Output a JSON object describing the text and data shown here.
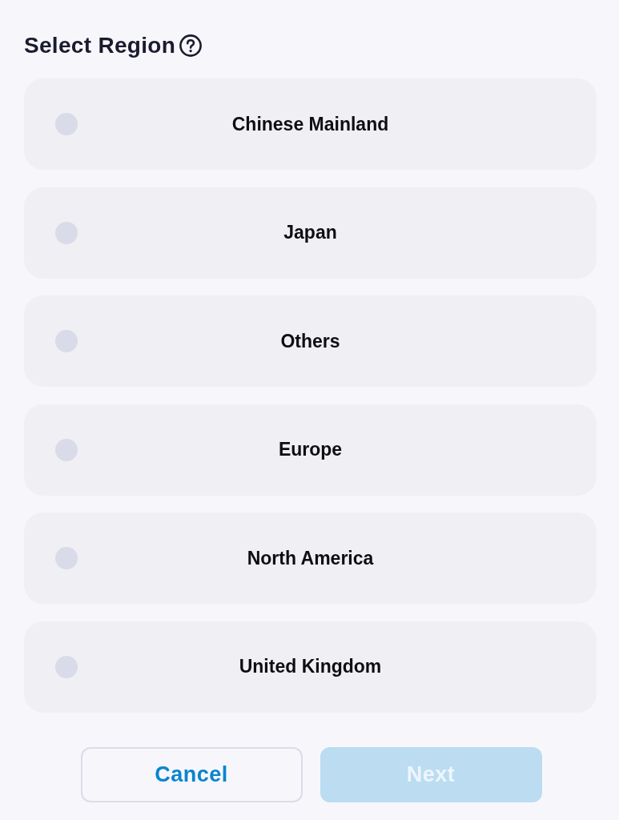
{
  "title": "Select Region",
  "regions": [
    {
      "label": "Chinese Mainland",
      "selected": false
    },
    {
      "label": "Japan",
      "selected": false
    },
    {
      "label": "Others",
      "selected": false
    },
    {
      "label": "Europe",
      "selected": false
    },
    {
      "label": "North America",
      "selected": false
    },
    {
      "label": "United Kingdom",
      "selected": false
    }
  ],
  "buttons": [
    {
      "label": "Cancel",
      "kind": "secondary",
      "disabled": false
    },
    {
      "label": "Next",
      "kind": "primary",
      "disabled": true
    }
  ]
}
